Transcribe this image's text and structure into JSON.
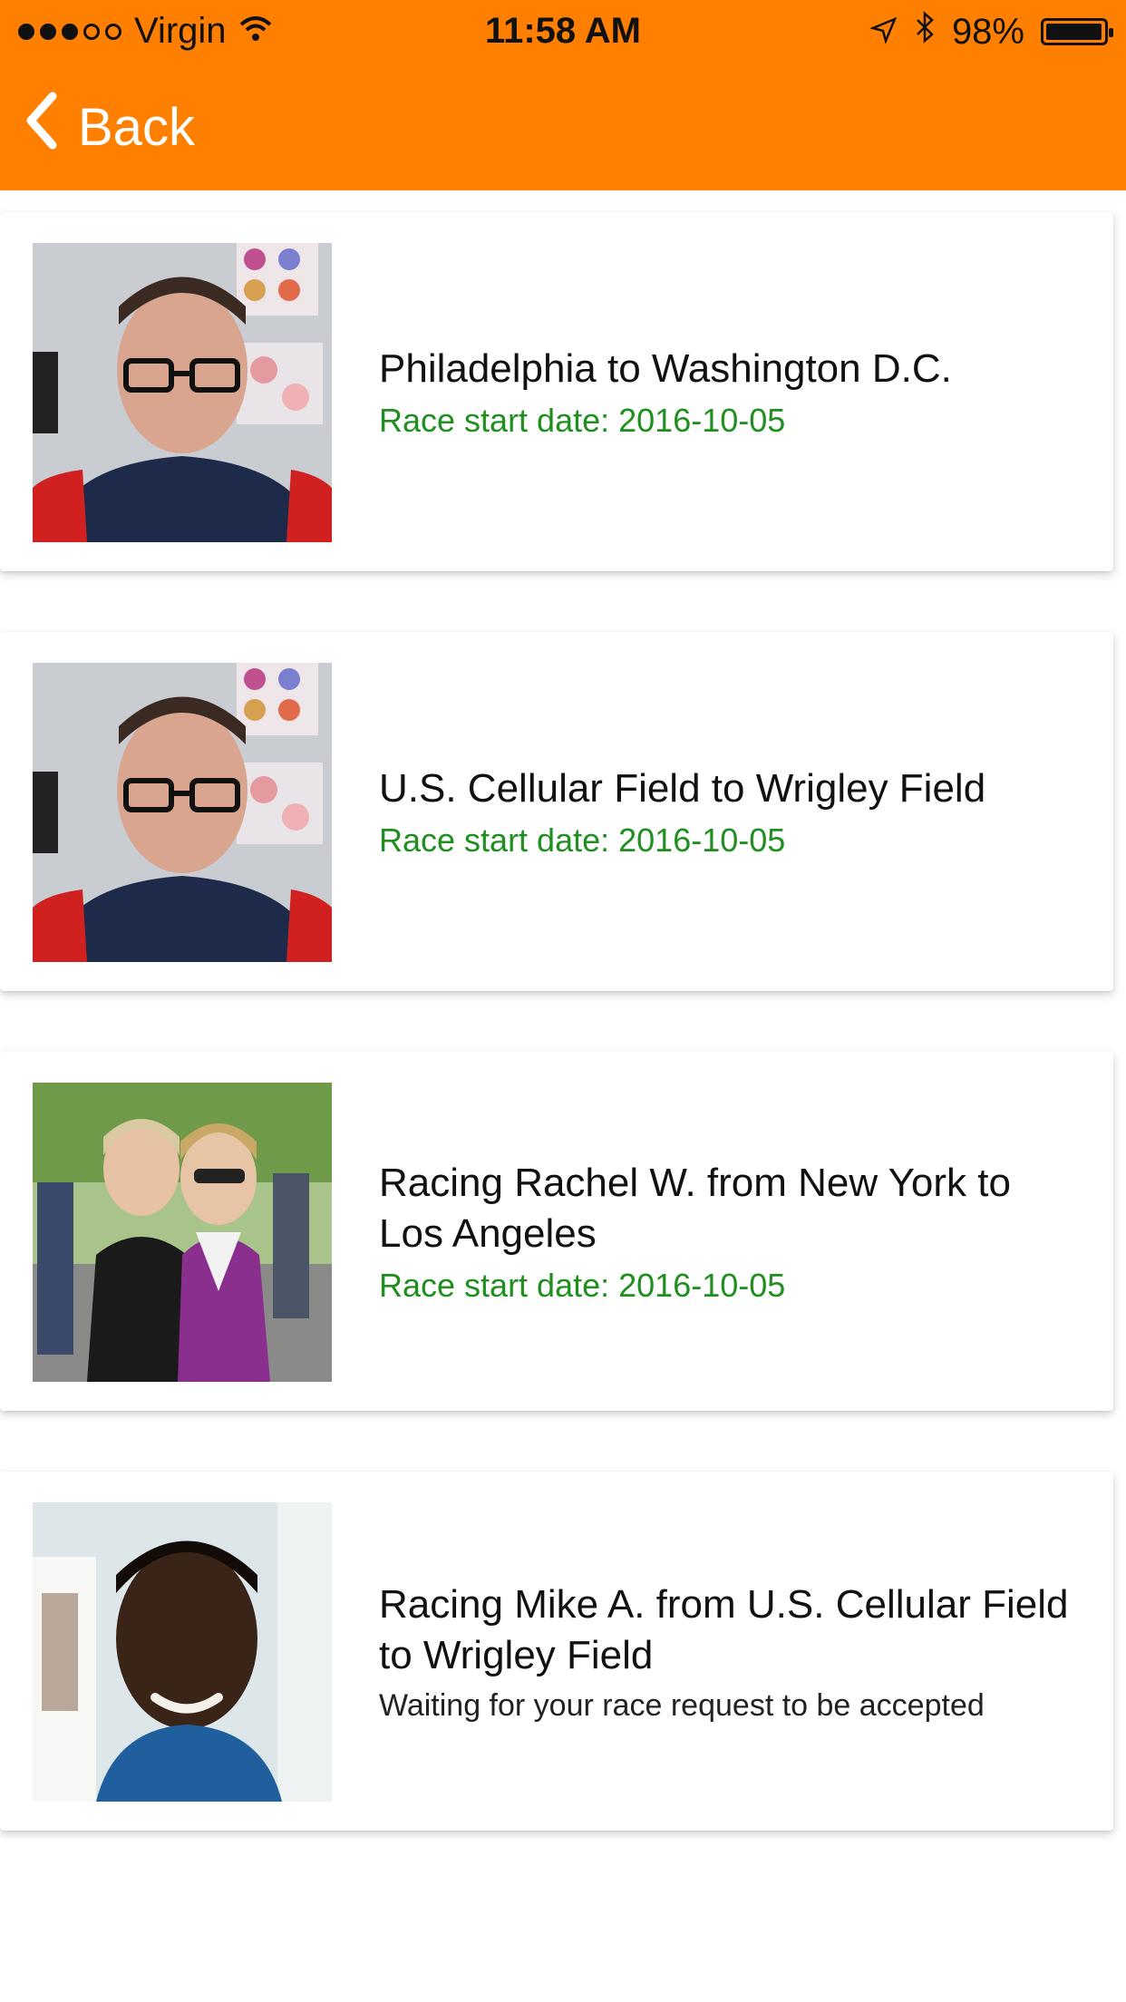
{
  "status_bar": {
    "carrier": "Virgin",
    "time": "11:58 AM",
    "battery": "98%",
    "signal_filled": 3,
    "signal_total": 5,
    "battery_level": 0.98,
    "icons": [
      "wifi-icon",
      "location-icon",
      "bluetooth-icon",
      "battery-icon"
    ]
  },
  "nav": {
    "back_label": "Back"
  },
  "races": [
    {
      "title": "Philadelphia to Washington D.C.",
      "subtitle": "Race start date: 2016-10-05",
      "subtitle_type": "date",
      "avatar": "man-glasses-selfie"
    },
    {
      "title": "U.S. Cellular Field to Wrigley Field",
      "subtitle": "Race start date: 2016-10-05",
      "subtitle_type": "date",
      "avatar": "man-glasses-selfie"
    },
    {
      "title": "Racing Rachel W. from New York to Los Angeles",
      "subtitle": "Race start date: 2016-10-05",
      "subtitle_type": "date",
      "avatar": "two-women-outdoors"
    },
    {
      "title": "Racing Mike A. from U.S. Cellular Field to Wrigley Field",
      "subtitle": "Waiting for your race request to be accepted",
      "subtitle_type": "pending",
      "avatar": "man-smiling-blue-shirt"
    }
  ],
  "colors": {
    "header": "#ff7f00",
    "date_text": "#1f8f1f"
  }
}
